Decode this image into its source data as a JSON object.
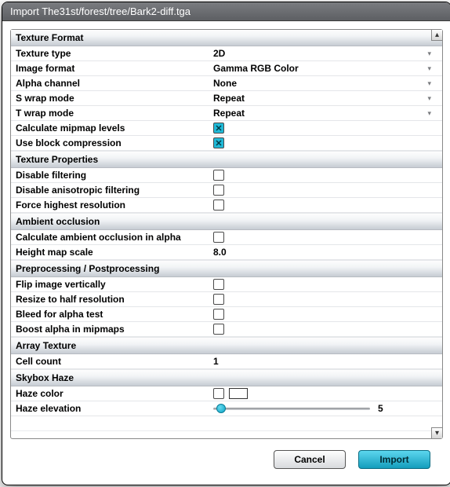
{
  "window": {
    "title": "Import The31st/forest/tree/Bark2-diff.tga"
  },
  "sections": {
    "textureFormat": {
      "header": "Texture Format",
      "textureType": {
        "label": "Texture type",
        "value": "2D"
      },
      "imageFormat": {
        "label": "Image format",
        "value": "Gamma RGB Color"
      },
      "alphaChannel": {
        "label": "Alpha channel",
        "value": "None"
      },
      "sWrap": {
        "label": "S wrap mode",
        "value": "Repeat"
      },
      "tWrap": {
        "label": "T wrap mode",
        "value": "Repeat"
      },
      "calcMipmap": {
        "label": "Calculate mipmap levels",
        "checked": true
      },
      "blockCompress": {
        "label": "Use block compression",
        "checked": true
      }
    },
    "textureProperties": {
      "header": "Texture Properties",
      "disableFiltering": {
        "label": "Disable filtering",
        "checked": false
      },
      "disableAniso": {
        "label": "Disable anisotropic filtering",
        "checked": false
      },
      "forceHighest": {
        "label": "Force highest resolution",
        "checked": false
      }
    },
    "ambientOcclusion": {
      "header": "Ambient occlusion",
      "calcAO": {
        "label": "Calculate ambient occlusion in alpha",
        "checked": false
      },
      "heightScale": {
        "label": "Height map scale",
        "value": "8.0"
      }
    },
    "preprocessing": {
      "header": "Preprocessing / Postprocessing",
      "flipVert": {
        "label": "Flip image vertically",
        "checked": false
      },
      "resizeHalf": {
        "label": "Resize to half resolution",
        "checked": false
      },
      "bleedAlpha": {
        "label": "Bleed for alpha test",
        "checked": false
      },
      "boostAlpha": {
        "label": "Boost alpha in mipmaps",
        "checked": false
      }
    },
    "arrayTexture": {
      "header": "Array Texture",
      "cellCount": {
        "label": "Cell count",
        "value": "1"
      }
    },
    "skyboxHaze": {
      "header": "Skybox Haze",
      "hazeColor": {
        "label": "Haze color",
        "checked": false,
        "color": "#ffffff"
      },
      "hazeElevation": {
        "label": "Haze elevation",
        "value": "5",
        "min": 0,
        "max": 100
      }
    }
  },
  "buttons": {
    "cancel": "Cancel",
    "import": "Import"
  }
}
